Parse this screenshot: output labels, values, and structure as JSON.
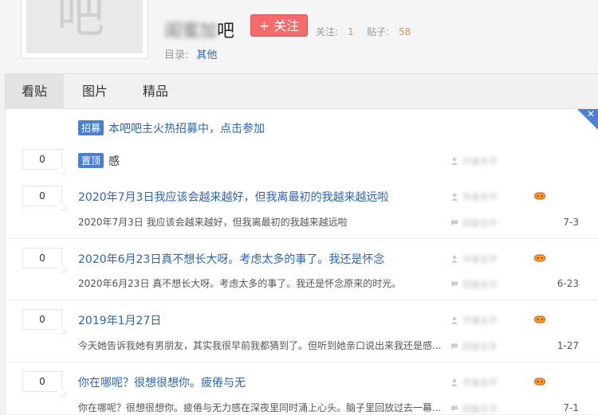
{
  "header": {
    "avatar_char": "吧",
    "forum_name_blurred": "闺蜜加",
    "forum_name_suffix": "吧",
    "follow_label": "+ 关注",
    "follow_count_label": "关注:",
    "follow_count": "1",
    "post_count_label": "贴子:",
    "post_count": "58",
    "catalog_label": "目录:",
    "catalog_value": "其他"
  },
  "tabs": [
    "看贴",
    "图片",
    "精品"
  ],
  "announcement": {
    "badge": "招募",
    "text": "本吧吧主火热招募中，点击参加"
  },
  "posts": [
    {
      "replies": "0",
      "badge": "置顶",
      "title": "感",
      "author": "作者名字",
      "has_level": false
    },
    {
      "replies": "0",
      "title": "2020年7月3日我应该会越来越好，但我离最初的我越来越远啦",
      "excerpt": "2020年7月3日 我应该会越来越好，但我离最初的我越来越远啦",
      "author": "作者名字",
      "last_reply": "回复名字",
      "date": "7-3",
      "has_level": true
    },
    {
      "replies": "0",
      "title": "2020年6月23日真不想长大呀。考虑太多的事了。我还是怀念",
      "excerpt": "2020年6月23日 真不想长大呀。考虑太多的事了。我还是怀念原来的时光。",
      "author": "作者名字",
      "last_reply": "回复名字",
      "date": "6-23",
      "has_level": true
    },
    {
      "replies": "0",
      "title": "2019年1月27日",
      "excerpt": "今天她告诉我她有男朋友，其实我很早前我都猜到了。但听到她亲口说出来我还是感...",
      "author": "作者名字",
      "last_reply": "回复名字",
      "date": "1-27",
      "has_level": true
    },
    {
      "replies": "0",
      "title": "你在哪呢？很想很想你。疲倦与无",
      "excerpt": "你在哪呢？很想很想你。疲倦与无力感在深夜里同时涌上心头。脑子里回放过去一幕...",
      "author": "作者名字",
      "last_reply": "回复名字",
      "date": "7-1",
      "has_level": true
    }
  ],
  "colors": {
    "link": "#2d64b3",
    "badge": "#4a7fd4",
    "follow_button": "#f56b6b",
    "count": "#f58a3c"
  }
}
